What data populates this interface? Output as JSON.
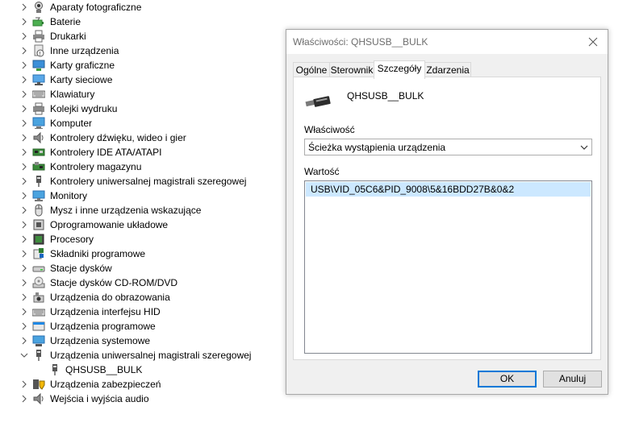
{
  "tree": {
    "items": [
      {
        "label": "Aparaty fotograficzne",
        "icon": "camera-icon",
        "expanded": false
      },
      {
        "label": "Baterie",
        "icon": "battery-icon",
        "expanded": false
      },
      {
        "label": "Drukarki",
        "icon": "printer-icon",
        "expanded": false
      },
      {
        "label": "Inne urządzenia",
        "icon": "unknown-device-icon",
        "expanded": false
      },
      {
        "label": "Karty graficzne",
        "icon": "display-adapter-icon",
        "expanded": false
      },
      {
        "label": "Karty sieciowe",
        "icon": "network-adapter-icon",
        "expanded": false
      },
      {
        "label": "Klawiatury",
        "icon": "keyboard-icon",
        "expanded": false
      },
      {
        "label": "Kolejki wydruku",
        "icon": "print-queue-icon",
        "expanded": false
      },
      {
        "label": "Komputer",
        "icon": "computer-icon",
        "expanded": false
      },
      {
        "label": "Kontrolery dźwięku, wideo i gier",
        "icon": "speaker-icon",
        "expanded": false
      },
      {
        "label": "Kontrolery IDE ATA/ATAPI",
        "icon": "ide-controller-icon",
        "expanded": false
      },
      {
        "label": "Kontrolery magazynu",
        "icon": "storage-controller-icon",
        "expanded": false
      },
      {
        "label": "Kontrolery uniwersalnej magistrali szeregowej",
        "icon": "usb-controller-icon",
        "expanded": false
      },
      {
        "label": "Monitory",
        "icon": "monitor-icon",
        "expanded": false
      },
      {
        "label": "Mysz i inne urządzenia wskazujące",
        "icon": "mouse-icon",
        "expanded": false
      },
      {
        "label": "Oprogramowanie układowe",
        "icon": "firmware-icon",
        "expanded": false
      },
      {
        "label": "Procesory",
        "icon": "processor-icon",
        "expanded": false
      },
      {
        "label": "Składniki programowe",
        "icon": "software-component-icon",
        "expanded": false
      },
      {
        "label": "Stacje dysków",
        "icon": "disk-drive-icon",
        "expanded": false
      },
      {
        "label": "Stacje dysków CD-ROM/DVD",
        "icon": "cdrom-icon",
        "expanded": false
      },
      {
        "label": "Urządzenia do obrazowania",
        "icon": "imaging-device-icon",
        "expanded": false
      },
      {
        "label": "Urządzenia interfejsu HID",
        "icon": "hid-icon",
        "expanded": false
      },
      {
        "label": "Urządzenia programowe",
        "icon": "software-device-icon",
        "expanded": false
      },
      {
        "label": "Urządzenia systemowe",
        "icon": "system-device-icon",
        "expanded": false
      },
      {
        "label": "Urządzenia uniwersalnej magistrali szeregowej",
        "icon": "usb-device-icon",
        "expanded": true
      },
      {
        "label": "QHSUSB__BULK",
        "icon": "usb-plug-icon",
        "child": true
      },
      {
        "label": "Urządzenia zabezpieczeń",
        "icon": "security-device-icon",
        "expanded": false
      },
      {
        "label": "Wejścia i wyjścia audio",
        "icon": "audio-io-icon",
        "expanded": false
      }
    ]
  },
  "dialog": {
    "title": "Właściwości: QHSUSB__BULK",
    "tabs": [
      {
        "label": "Ogólne",
        "active": false
      },
      {
        "label": "Sterownik",
        "active": false
      },
      {
        "label": "Szczegóły",
        "active": true
      },
      {
        "label": "Zdarzenia",
        "active": false
      }
    ],
    "device_name": "QHSUSB__BULK",
    "property_label": "Właściwość",
    "property_selected": "Ścieżka wystąpienia urządzenia",
    "value_label": "Wartość",
    "values": [
      "USB\\VID_05C6&PID_9008\\5&16BDD27B&0&2"
    ],
    "ok_label": "OK",
    "cancel_label": "Anuluj"
  },
  "colors": {
    "selection": "#cce8ff",
    "accent": "#0078d7",
    "dialog_bg": "#f0f0f0"
  }
}
